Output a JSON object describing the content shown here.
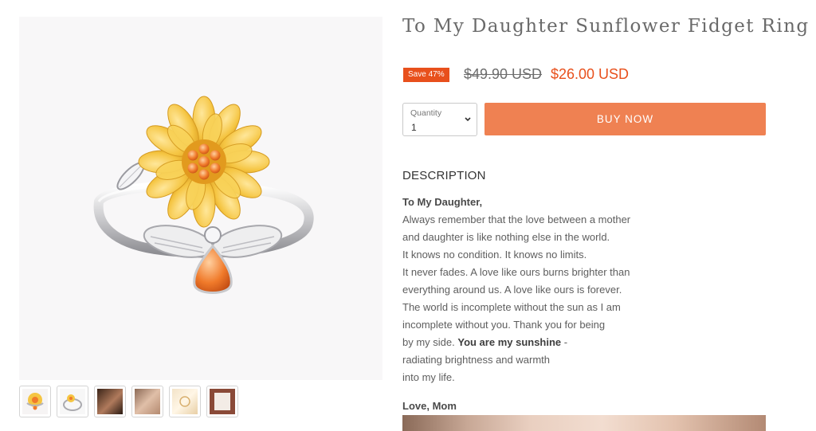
{
  "product": {
    "title": "To My Daughter Sunflower Fidget Ring",
    "save_badge": "Save 47%",
    "compare_price": "$49.90 USD",
    "price": "$26.00 USD"
  },
  "purchase": {
    "quantity_label": "Quantity",
    "quantity_value": "1",
    "buy_label": "BUY NOW"
  },
  "description": {
    "heading": "DESCRIPTION",
    "greeting": "To My Daughter,",
    "lines": [
      "Always remember that the love between a mother",
      "and daughter is like nothing else in the world.",
      "It knows no condition. It knows no limits.",
      "It never fades. A love like ours burns brighter than",
      "everything around us. A love like ours is forever.",
      "The world is incomplete without the sun as I am",
      "incomplete without you. Thank you for being"
    ],
    "line8_prefix": "by my side. ",
    "line8_bold": "You are my sunshine",
    "line8_suffix": " -",
    "lines_end": [
      "radiating brightness and warmth",
      "into my life."
    ],
    "signoff": "Love, Mom"
  },
  "gallery": {
    "thumbnails": [
      "sunflower-ring-thumb",
      "ring-side-thumb",
      "ring-on-hand-thumb",
      "ring-closeup-thumb",
      "ring-box-thumb",
      "gift-card-thumb"
    ]
  },
  "colors": {
    "accent": "#e8501c",
    "button": "#ef8152",
    "petal": "#f5c542",
    "stone": "#f07a2a"
  }
}
